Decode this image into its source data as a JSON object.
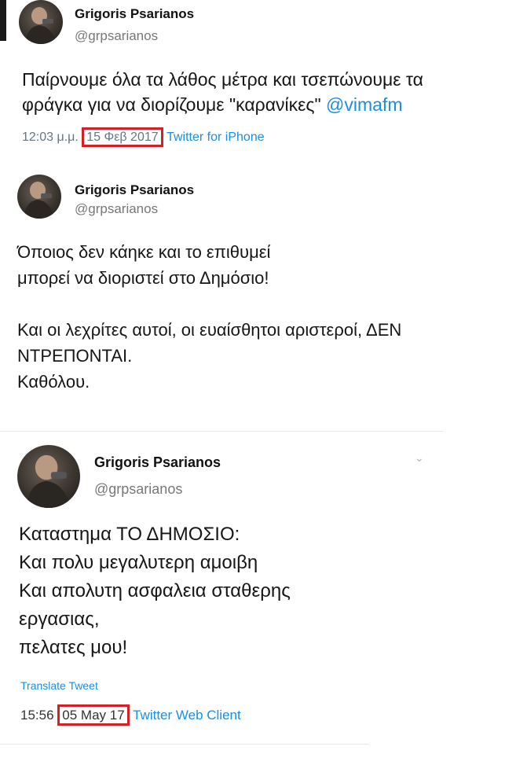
{
  "tweets": [
    {
      "name": "Grigoris Psarianos",
      "handle": "@grpsarianos",
      "text": "Παίρνουμε όλα τα λάθος μέτρα και τσεπώνουμε τα",
      "text2": "φράγκα για να διορίζουμε \"καρανίκες\"",
      "mention": "@vimafm",
      "time": "12:03 μ.μ.",
      "date": "15 Φεβ 2017",
      "client": "Twitter for iPhone"
    },
    {
      "name": "Grigoris Psarianos",
      "handle": "@grpsarianos",
      "lines": [
        "Όποιος δεν κάηκε και το επιθυμεί",
        "μπορεί να διοριστεί στο Δημόσιο!",
        "",
        "Και οι λεχρίτες αυτοί, οι ευαίσθητοι  αριστεροί, ΔΕΝ",
        "ΝΤΡΕΠΟΝΤΑΙ.",
        "Καθόλου."
      ]
    },
    {
      "name": "Grigoris Psarianos",
      "handle": "@grpsarianos",
      "lines": [
        "Καταστημα ΤΟ ΔΗΜΟΣΙΟ:",
        "Και πολυ μεγαλυτερη αμοιβη",
        "Και απολυτη ασφαλεια σταθερης",
        "εργασιας,",
        "πελατες μου!"
      ],
      "translate": "Translate Tweet",
      "time": "15:56",
      "date": "05 May 17",
      "client": "Twitter Web Client"
    }
  ],
  "colors": {
    "link": "#1b8ee0",
    "highlight": "#d32027",
    "meta": "#657786"
  }
}
